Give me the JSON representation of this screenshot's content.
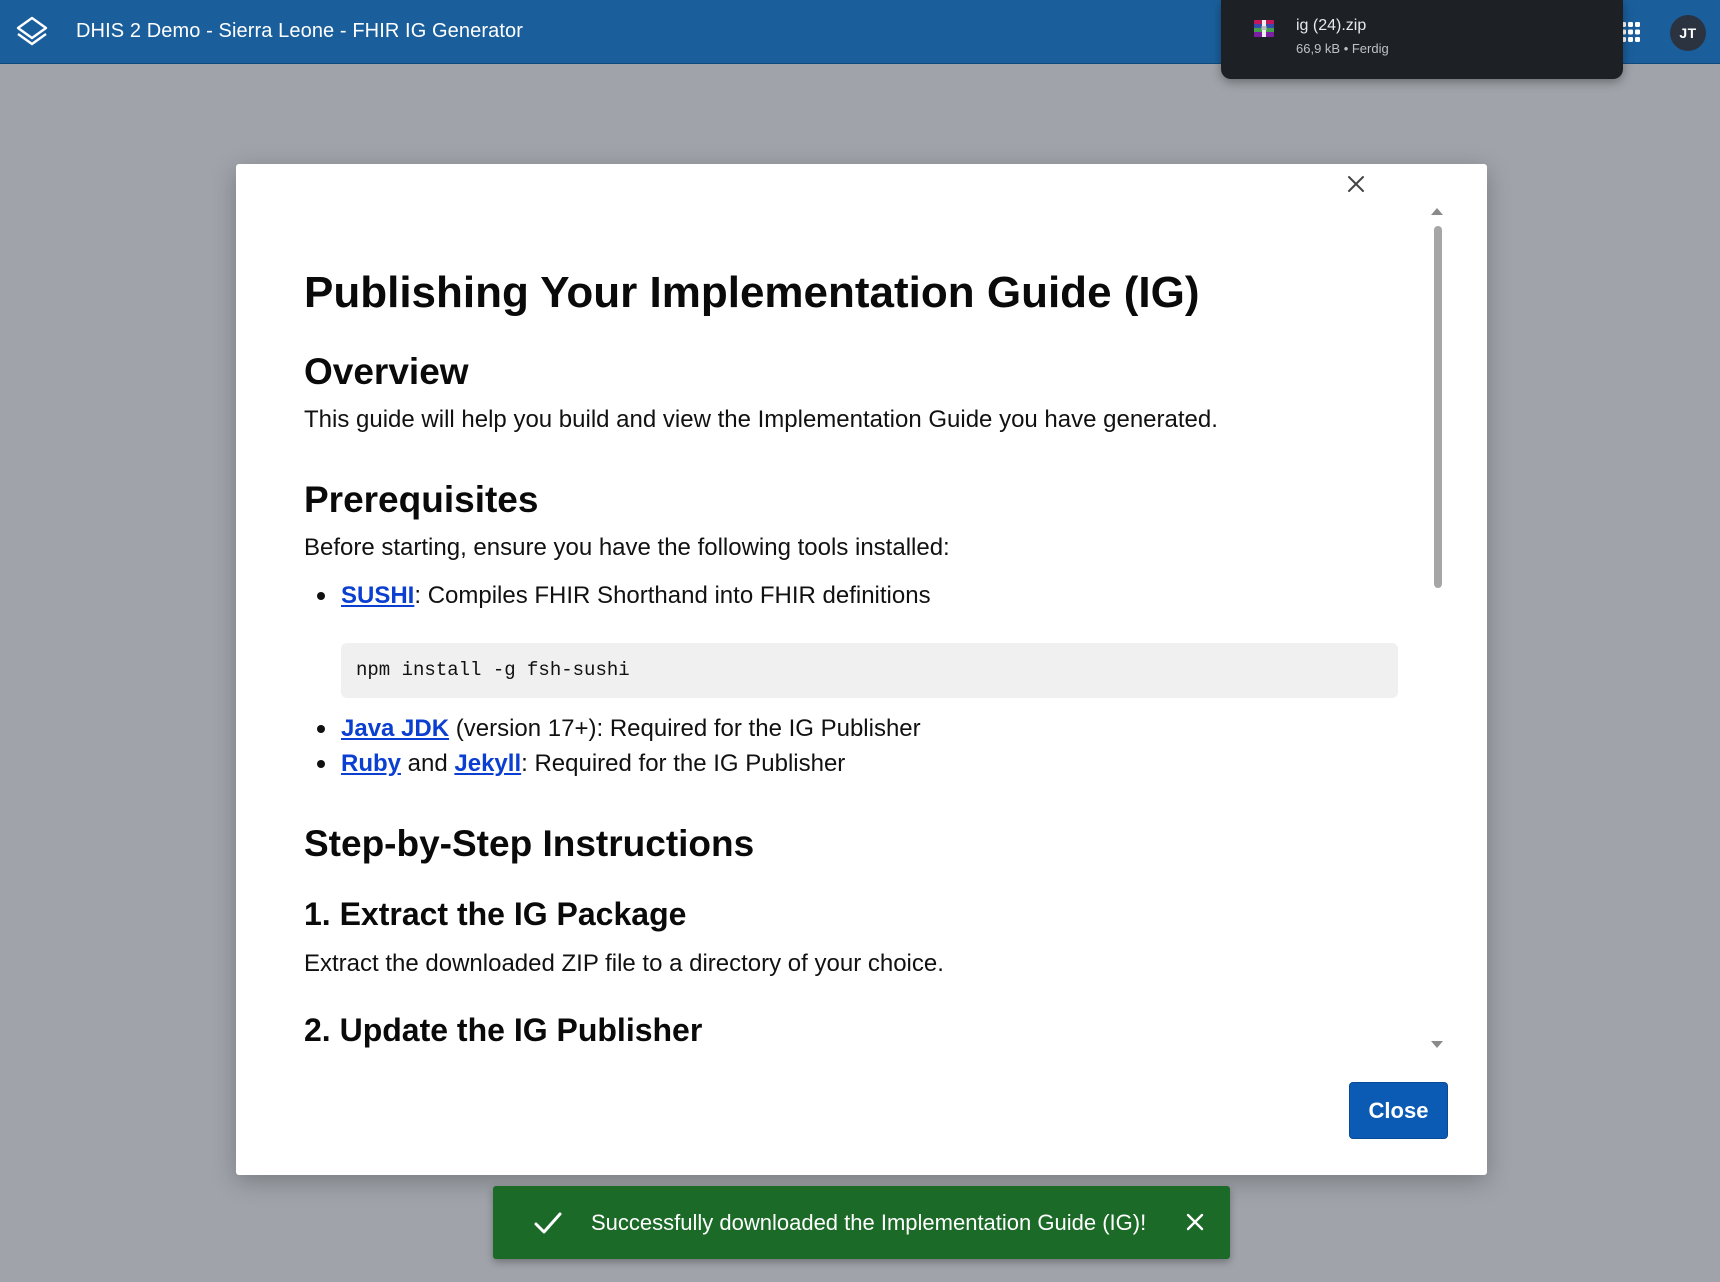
{
  "header": {
    "title": "DHIS 2 Demo - Sierra Leone - FHIR IG Generator",
    "avatar_initials": "JT",
    "logo_icon": "dhis2-logo-icon",
    "apps_icon": "apps-grid-icon",
    "background_color": "#1a5f9c"
  },
  "download": {
    "filename": "ig (24).zip",
    "status": "66,9 kB • Ferdig",
    "icon": "zip-archive-icon"
  },
  "modal": {
    "title": "Publishing Your Implementation Guide (IG)",
    "sections": {
      "overview": {
        "heading": "Overview",
        "text": "This guide will help you build and view the Implementation Guide you have generated."
      },
      "prerequisites": {
        "heading": "Prerequisites",
        "intro": "Before starting, ensure you have the following tools installed:",
        "items": [
          {
            "link": "SUSHI",
            "text": ": Compiles FHIR Shorthand into FHIR definitions",
            "code": "npm install -g fsh-sushi"
          },
          {
            "link": "Java JDK",
            "text": " (version 17+): Required for the IG Publisher"
          },
          {
            "link": "Ruby",
            "between": " and ",
            "link2": "Jekyll",
            "text": ": Required for the IG Publisher"
          }
        ]
      },
      "steps": {
        "heading": "Step-by-Step Instructions",
        "step1_heading": "1. Extract the IG Package",
        "step1_text": "Extract the downloaded ZIP file to a directory of your choice.",
        "step2_heading": "2. Update the IG Publisher"
      }
    },
    "close_button": "Close",
    "close_icon": "close-icon"
  },
  "toast": {
    "message": "Successfully downloaded the Implementation Guide (IG)!",
    "icon": "checkmark-icon",
    "close_icon": "close-icon",
    "color": "#1c6a28"
  }
}
